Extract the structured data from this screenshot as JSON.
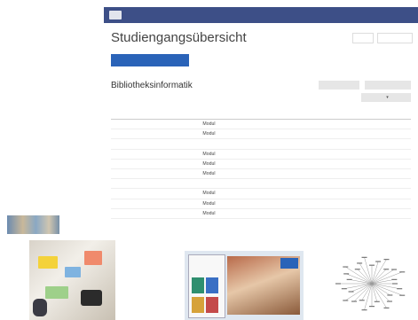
{
  "topbar": {
    "org": "",
    "links": [
      "",
      "",
      "",
      ""
    ]
  },
  "header": {
    "title": "Studiengangsübersicht",
    "btn_red": "",
    "btn_blue": ""
  },
  "actions": {
    "primary": ""
  },
  "section": {
    "heading": "Bibliotheksinformatik",
    "suffix": "",
    "filter1": "",
    "filter2": "",
    "filter3": "",
    "filter3_caret": "▾"
  },
  "table": {
    "headers": [
      "",
      "",
      "",
      "",
      "",
      ""
    ],
    "rows": [
      [
        "",
        "Modul",
        "",
        "",
        "",
        ""
      ],
      [
        "",
        "Modul",
        "",
        "",
        "",
        ""
      ],
      [
        "",
        "",
        "",
        "",
        "",
        ""
      ],
      [
        "",
        "Modul",
        "",
        "",
        "",
        ""
      ],
      [
        "",
        "Modul",
        "",
        "",
        "",
        ""
      ],
      [
        "",
        "Modul",
        "",
        "",
        "",
        ""
      ],
      [
        "",
        "",
        "",
        "",
        "",
        ""
      ],
      [
        "",
        "Modul",
        "",
        "",
        "",
        ""
      ],
      [
        "",
        "Modul",
        "",
        "",
        "",
        ""
      ],
      [
        "",
        "Modul",
        "",
        "",
        "",
        ""
      ]
    ]
  },
  "colors": {
    "topbar": "#3d4f87",
    "primary": "#2a63b8",
    "link": "#2a63b8"
  }
}
